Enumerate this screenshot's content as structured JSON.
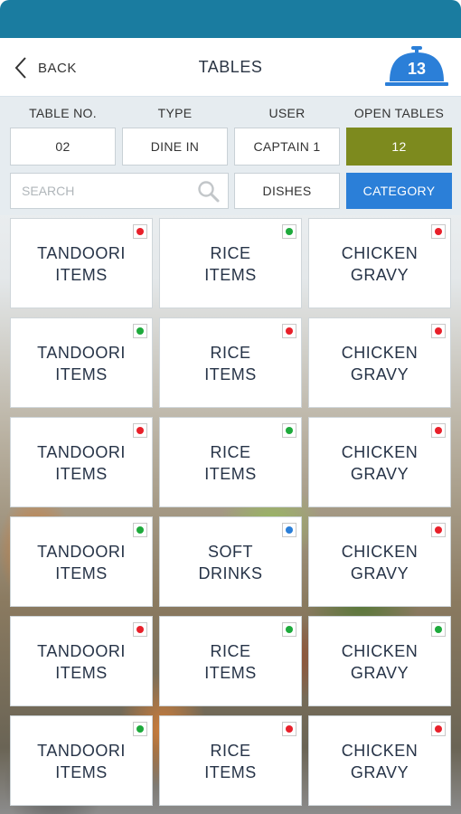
{
  "header": {
    "back_label": "BACK",
    "title": "TABLES",
    "order_count": "13"
  },
  "info": {
    "headers": [
      "TABLE NO.",
      "TYPE",
      "USER",
      "OPEN TABLES"
    ],
    "values": [
      "02",
      "DINE IN",
      "CAPTAIN 1",
      "12"
    ]
  },
  "search": {
    "placeholder": "SEARCH"
  },
  "tabs": {
    "dishes": "DISHES",
    "category": "CATEGORY"
  },
  "colors": {
    "header_bar": "#1a7ca0",
    "open_tables": "#7d8a1e",
    "active_tab": "#2b7fd8",
    "badge": "#2b7fd8",
    "red": "#e8202a",
    "green": "#1eaa3c",
    "blue": "#2b7fd8"
  },
  "categories": [
    {
      "label": "TANDOORI\nITEMS",
      "indicator": "red"
    },
    {
      "label": "RICE\nITEMS",
      "indicator": "green"
    },
    {
      "label": "CHICKEN\nGRAVY",
      "indicator": "red"
    },
    {
      "label": "TANDOORI\nITEMS",
      "indicator": "green"
    },
    {
      "label": "RICE\nITEMS",
      "indicator": "red"
    },
    {
      "label": "CHICKEN\nGRAVY",
      "indicator": "red"
    },
    {
      "label": "TANDOORI\nITEMS",
      "indicator": "red"
    },
    {
      "label": "RICE\nITEMS",
      "indicator": "green"
    },
    {
      "label": "CHICKEN\nGRAVY",
      "indicator": "red"
    },
    {
      "label": "TANDOORI\nITEMS",
      "indicator": "green"
    },
    {
      "label": "SOFT\nDRINKS",
      "indicator": "blue"
    },
    {
      "label": "CHICKEN\nGRAVY",
      "indicator": "red"
    },
    {
      "label": "TANDOORI\nITEMS",
      "indicator": "red"
    },
    {
      "label": "RICE\nITEMS",
      "indicator": "green"
    },
    {
      "label": "CHICKEN\nGRAVY",
      "indicator": "green"
    },
    {
      "label": "TANDOORI\nITEMS",
      "indicator": "green"
    },
    {
      "label": "RICE\nITEMS",
      "indicator": "red"
    },
    {
      "label": "CHICKEN\nGRAVY",
      "indicator": "red"
    }
  ]
}
